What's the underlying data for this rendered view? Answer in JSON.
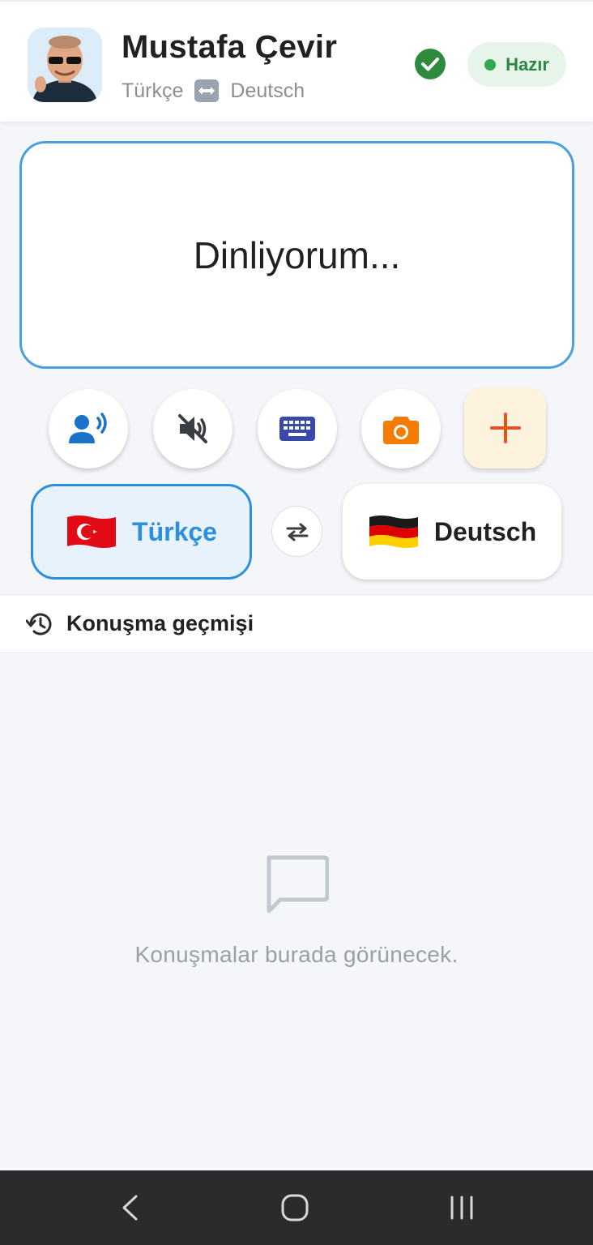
{
  "header": {
    "name": "Mustafa Çevir",
    "source_language": "Türkçe",
    "target_language": "Deutsch",
    "status_label": "Hazır",
    "status_color": "#2fa84f"
  },
  "listening": {
    "text": "Dinliyorum..."
  },
  "actions": {
    "items": [
      "voice-speaker-icon",
      "mute-icon",
      "keyboard-icon",
      "camera-icon"
    ],
    "add_icon": "plus-icon"
  },
  "languages": {
    "source": {
      "label": "Türkçe",
      "flag": "turkey-flag"
    },
    "target": {
      "label": "Deutsch",
      "flag": "germany-flag"
    },
    "swap_icon": "swap-arrows-icon"
  },
  "history": {
    "title": "Konuşma geçmişi",
    "empty_text": "Konuşmalar burada görünecek."
  },
  "colors": {
    "accent": "#2c8fdd",
    "orange": "#f57c00",
    "indigo": "#3949ab"
  },
  "navigation": [
    "back-icon",
    "home-icon",
    "recents-icon"
  ]
}
